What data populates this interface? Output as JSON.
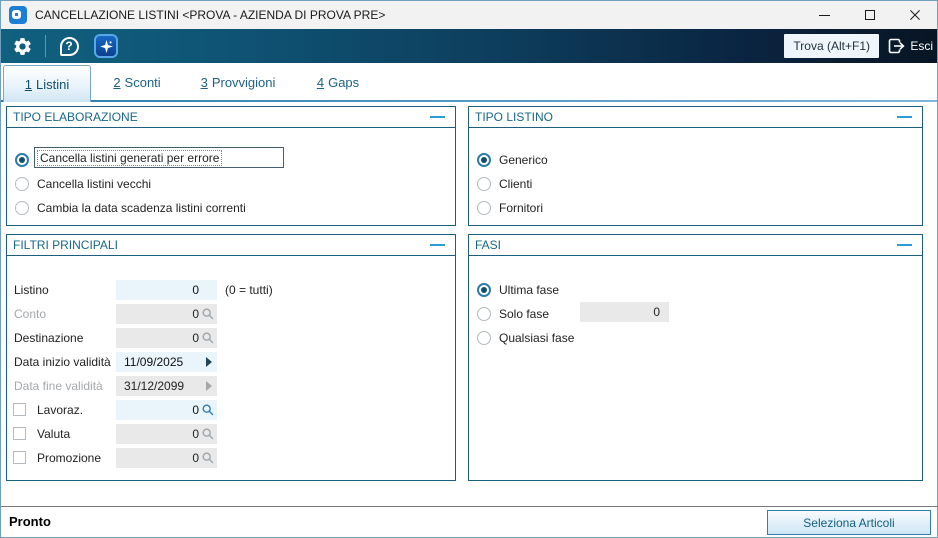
{
  "window": {
    "title": "CANCELLAZIONE LISTINI <PROVA - AZIENDA DI PROVA PRE>"
  },
  "toolbar": {
    "help_glyph": "?",
    "trova_label": "Trova (Alt+F1)",
    "esci_label": "Esci"
  },
  "tabs": [
    {
      "number": "1",
      "label": "Listini",
      "active": true
    },
    {
      "number": "2",
      "label": "Sconti",
      "active": false
    },
    {
      "number": "3",
      "label": "Provvigioni",
      "active": false
    },
    {
      "number": "4",
      "label": "Gaps",
      "active": false
    }
  ],
  "groups": {
    "tipo_elaborazione": {
      "title": "TIPO ELABORAZIONE",
      "options": [
        {
          "label": "Cancella listini generati per errore",
          "selected": true,
          "focused": true
        },
        {
          "label": "Cancella listini vecchi",
          "selected": false
        },
        {
          "label": "Cambia la data scadenza listini correnti",
          "selected": false
        }
      ]
    },
    "tipo_listino": {
      "title": "TIPO LISTINO",
      "options": [
        {
          "label": "Generico",
          "selected": true
        },
        {
          "label": "Clienti",
          "selected": false
        },
        {
          "label": "Fornitori",
          "selected": false
        }
      ]
    },
    "filtri_principali": {
      "title": "FILTRI PRINCIPALI",
      "rows": [
        {
          "label": "Listino",
          "value": "0",
          "note": "(0 = tutti)",
          "disabled": false
        },
        {
          "label": "Conto",
          "value": "0",
          "disabled": true,
          "lookup": true
        },
        {
          "label": "Destinazione",
          "value": "0",
          "disabled": true,
          "lookup": true
        },
        {
          "label": "Data inizio validità",
          "value": "11/09/2025",
          "disabled": false,
          "arrow": true
        },
        {
          "label": "Data fine validità",
          "value": "31/12/2099",
          "disabled": true,
          "arrow": true
        },
        {
          "label": "Lavoraz.",
          "value": "0",
          "checkbox": true,
          "checked": false,
          "disabled": false,
          "lookup": true
        },
        {
          "label": "Valuta",
          "value": "0",
          "checkbox": true,
          "checked": false,
          "disabled": true,
          "lookup": true
        },
        {
          "label": "Promozione",
          "value": "0",
          "checkbox": true,
          "checked": false,
          "disabled": true,
          "lookup": true
        }
      ]
    },
    "fasi": {
      "title": "FASI",
      "options": [
        {
          "label": "Ultima fase",
          "selected": true
        },
        {
          "label": "Solo fase",
          "selected": false,
          "field_value": "0"
        },
        {
          "label": "Qualsiasi fase",
          "selected": false
        }
      ]
    }
  },
  "statusbar": {
    "status": "Pronto",
    "action_button": "Seleziona Articoli"
  },
  "colors": {
    "toolbar_teal": "#10607f",
    "toolbar_dark": "#081523",
    "group_border": "#1b5e7d",
    "group_title": "#18678a",
    "accent_blue": "#2b9cd8",
    "field_enabled_bg": "#eaf4fb",
    "field_disabled_bg": "#e9e9e9",
    "radio_selected": "#124f6e",
    "button_text": "#135f80"
  }
}
